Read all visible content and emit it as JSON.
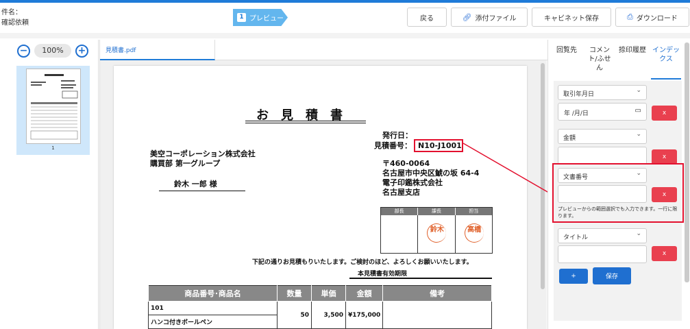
{
  "header": {
    "subject_label": "件名：",
    "subject_value": "確認依頼",
    "step_number": "1",
    "step_label": "プレビュー",
    "back_label": "戻る",
    "attach_label": "添付ファイル",
    "cabinet_label": "キャビネット保存",
    "download_label": "ダウンロード"
  },
  "thumbs": {
    "zoom_level": "100%",
    "page_number": "1"
  },
  "viewer": {
    "file_tab": "見積書.pdf"
  },
  "document": {
    "title": "お見積書",
    "issue_date_label": "発行日：",
    "quote_no_label": "見積番号：",
    "quote_no": "N10-J1001",
    "client_company": "美空コーポレーション株式会社",
    "client_dept": "購買部 第一グループ",
    "client_person": "鈴木 一郎 様",
    "vendor_zip": "〒460-0064",
    "vendor_address": "名古屋市中央区鯱の坂 64-4",
    "vendor_company": "電子印鑑株式会社",
    "vendor_branch": "名古屋支店",
    "stamp_headers": [
      "部長",
      "課長",
      "担当"
    ],
    "seals": [
      "鈴木",
      "高橋"
    ],
    "intro": "下記の通りお見積もりいたします。ご検討のほど、よろしくお願いいたします。",
    "validity": "本見積書有効期限",
    "table_headers": [
      "商品番号･商品名",
      "数量",
      "単価",
      "金額",
      "備考"
    ],
    "row1_code": "101",
    "row1_name": "ハンコ付きボールペン",
    "row1_qty": "50",
    "row1_price": "3,500",
    "row1_amount": "¥175,000"
  },
  "side": {
    "tabs": [
      "回覧先",
      "コメント/ふせん",
      "捺印履歴",
      "インデックス"
    ],
    "field1_label": "取引年月日",
    "field1_value": "年 /月/日",
    "field2_label": "金額",
    "field3_label": "文書番号",
    "field3_note": "プレビューからの範囲選択でも入力できます。一行に限ります。",
    "field4_label": "タイトル",
    "remove_label": "x",
    "add_label": "+",
    "save_label": "保存"
  },
  "colors": {
    "accent": "#1f7bd8",
    "danger": "#e9404f",
    "highlight": "#e3102e"
  }
}
